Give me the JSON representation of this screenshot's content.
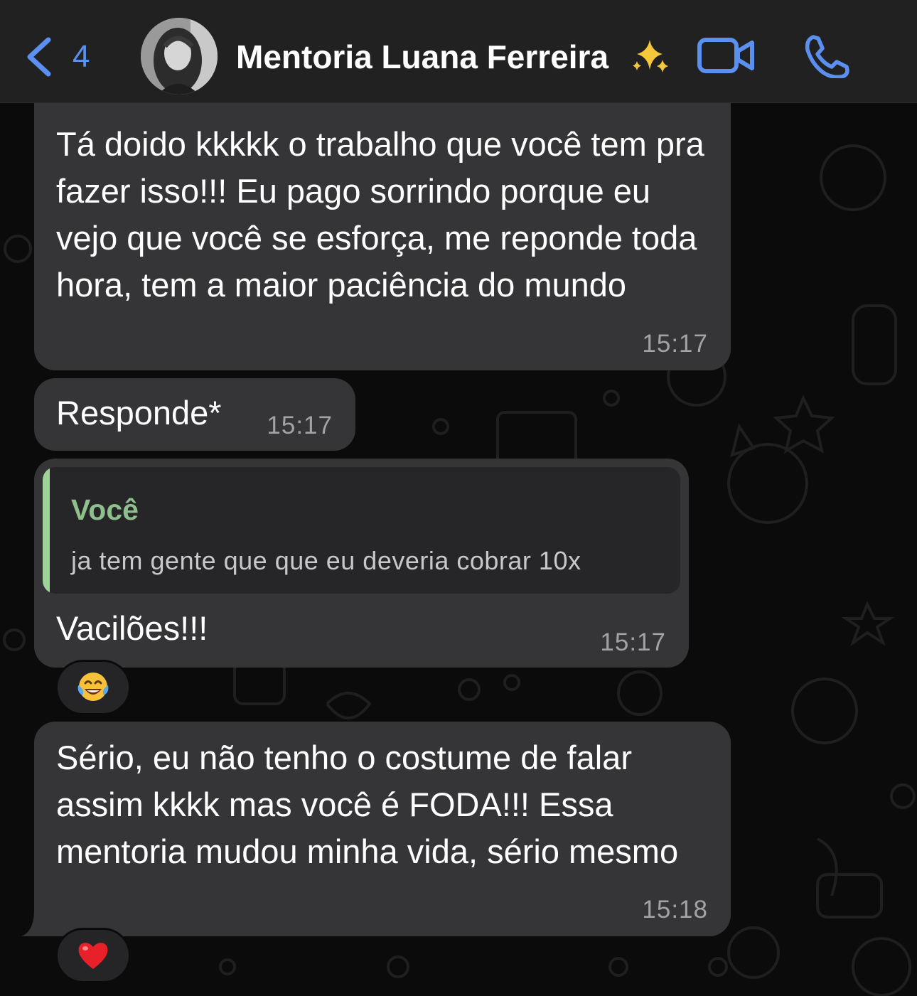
{
  "header": {
    "back_count": "4",
    "contact_name": "Mentoria Luana Ferreira",
    "name_emoji": "sparkles-icon",
    "back_icon": "chevron-left-icon",
    "video_icon": "video-camera-icon",
    "call_icon": "phone-icon",
    "accent_color": "#5b8ff0"
  },
  "messages": [
    {
      "text": "Tá doido kkkkk o trabalho que você tem pra fazer isso!!! Eu pago sorrindo porque eu vejo que você se esforça, me reponde toda hora, tem a maior paciência do mundo",
      "time": "15:17"
    },
    {
      "text": "Responde*",
      "time": "15:17"
    },
    {
      "quote": {
        "author": "Você",
        "text": "ja tem gente que que eu deveria cobrar 10x"
      },
      "text": "Vacilões!!!",
      "time": "15:17",
      "reaction": "face-with-tears-of-joy-icon"
    },
    {
      "text": "Sério, eu não tenho o costume de falar assim kkkk mas você é FODA!!! Essa mentoria mudou minha vida, sério mesmo",
      "time": "15:18",
      "reaction": "red-heart-icon"
    }
  ],
  "colors": {
    "bubble": "#353537",
    "quote_bar": "#9ed39a",
    "quote_author": "#8fbf8c",
    "timestamp": "#a3a3a6",
    "background": "#0b0b0b"
  }
}
